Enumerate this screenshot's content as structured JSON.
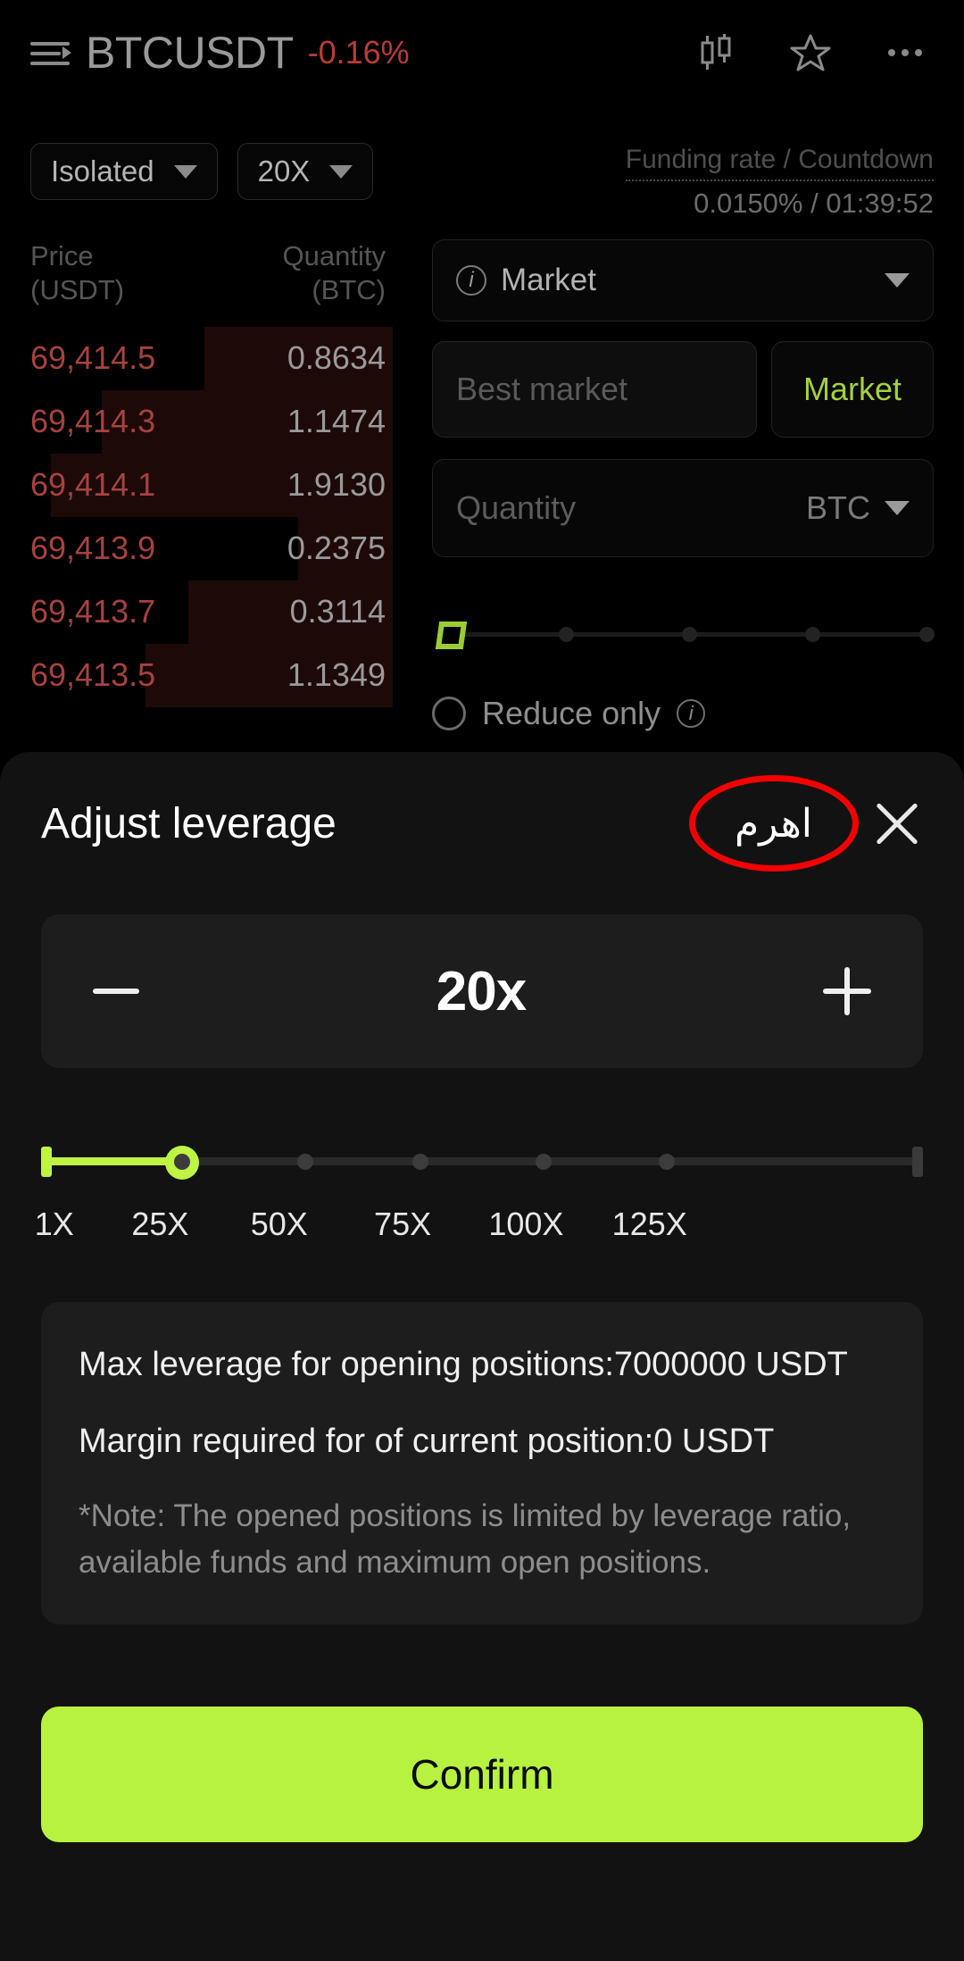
{
  "header": {
    "pair": "BTCUSDT",
    "change": "-0.16%",
    "change_color": "#b93c38",
    "icons": [
      "menu-list-icon",
      "candlestick-chart-icon",
      "star-favorite-icon",
      "more-options-icon"
    ]
  },
  "controls": {
    "margin_mode": "Isolated",
    "leverage": "20X"
  },
  "funding": {
    "label": "Funding rate / Countdown",
    "value": "0.0150% / 01:39:52"
  },
  "orderbook": {
    "col_price": "Price",
    "col_price_unit": "(USDT)",
    "col_qty": "Quantity",
    "col_qty_unit": "(BTC)",
    "rows": [
      {
        "price": "69,414.5",
        "qty": "0.8634",
        "depth": 48
      },
      {
        "price": "69,414.3",
        "qty": "1.1474",
        "depth": 74
      },
      {
        "price": "69,414.1",
        "qty": "1.9130",
        "depth": 87
      },
      {
        "price": "69,413.9",
        "qty": "0.2375",
        "depth": 24
      },
      {
        "price": "69,413.7",
        "qty": "0.3114",
        "depth": 52
      },
      {
        "price": "69,413.5",
        "qty": "1.1349",
        "depth": 63
      }
    ]
  },
  "order_form": {
    "order_type": "Market",
    "price_placeholder": "Best market",
    "price_button": "Market",
    "price_button_color": "#a3d13a",
    "qty_placeholder": "Quantity",
    "qty_unit": "BTC",
    "reduce_only": "Reduce only"
  },
  "sheet": {
    "title": "Adjust leverage",
    "annotation_text": "اهرم",
    "annotation_circle_color": "#f40000",
    "close_icon": "close-x-icon",
    "stepper": {
      "decrement": "−",
      "value": "20x",
      "increment": "+"
    },
    "slider": {
      "current": 20,
      "min": 1,
      "max": 125,
      "fill_percent": 16,
      "accent_color": "#bef442",
      "ticks": [
        {
          "label": "1X",
          "pos": 1.5
        },
        {
          "label": "25X",
          "pos": 19.5
        },
        {
          "label": "50X",
          "pos": 33
        },
        {
          "label": "75X",
          "pos": 47
        },
        {
          "label": "100X",
          "pos": 60
        },
        {
          "label": "125X",
          "pos": 72
        }
      ],
      "dot_positions": [
        16,
        30,
        43,
        57,
        71
      ],
      "labels_pos": [
        1.5,
        13.5,
        27,
        41,
        55,
        69
      ]
    },
    "info": {
      "max_leverage": "Max leverage for opening positions:7000000 USDT",
      "margin_required": "Margin required for of current position:0 USDT",
      "note": "*Note: The opened positions is limited by leverage ratio, available funds and maximum open positions."
    },
    "confirm_label": "Confirm",
    "confirm_color": "#b6f23f"
  }
}
